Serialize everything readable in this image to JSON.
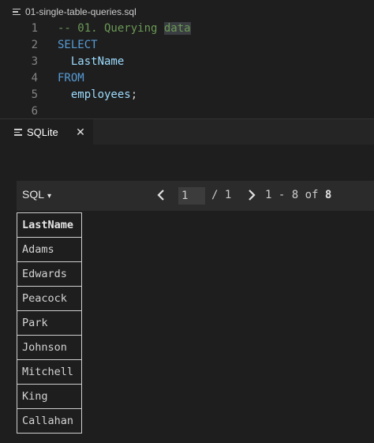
{
  "editor": {
    "breadcrumb": "01-single-table-queries.sql",
    "lines": [
      {
        "num": "1",
        "parts": [
          {
            "text": "-- 01. Querying ",
            "cls": "t-comment"
          },
          {
            "text": "data",
            "cls": "t-comment hl"
          }
        ]
      },
      {
        "num": "2",
        "parts": [
          {
            "text": "SELECT",
            "cls": "t-kw"
          }
        ]
      },
      {
        "num": "3",
        "parts": [
          {
            "text": "  LastName",
            "cls": "t-id"
          }
        ]
      },
      {
        "num": "4",
        "parts": [
          {
            "text": "FROM",
            "cls": "t-kw"
          }
        ]
      },
      {
        "num": "5",
        "parts": [
          {
            "text": "  employees",
            "cls": "t-id"
          },
          {
            "text": ";",
            "cls": "t-plain"
          }
        ]
      },
      {
        "num": "6",
        "parts": []
      }
    ]
  },
  "panel": {
    "tab_label": "SQLite",
    "close_symbol": "✕"
  },
  "toolbar": {
    "mode_label": "SQL",
    "mode_caret": "▾",
    "page_value": "1",
    "page_total": "/ 1",
    "range_text": "1 - 8 of ",
    "range_total": "8"
  },
  "results": {
    "columns": [
      "LastName"
    ],
    "rows": [
      [
        "Adams"
      ],
      [
        "Edwards"
      ],
      [
        "Peacock"
      ],
      [
        "Park"
      ],
      [
        "Johnson"
      ],
      [
        "Mitchell"
      ],
      [
        "King"
      ],
      [
        "Callahan"
      ]
    ]
  }
}
